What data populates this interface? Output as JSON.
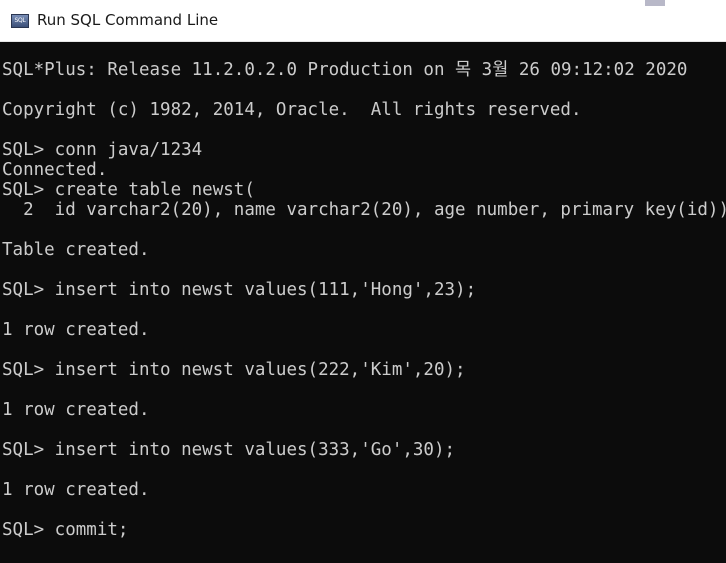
{
  "window": {
    "title": "Run SQL Command Line",
    "icon": "sql-plus-app-icon",
    "icon_label": "SQL"
  },
  "console": {
    "background_color": "#0c0c0c",
    "text_color": "#cccccc",
    "lines": [
      "SQL*Plus: Release 11.2.0.2.0 Production on 목 3월 26 09:12:02 2020",
      "",
      "Copyright (c) 1982, 2014, Oracle.  All rights reserved.",
      "",
      "SQL> conn java/1234",
      "Connected.",
      "SQL> create table newst(",
      "  2  id varchar2(20), name varchar2(20), age number, primary key(id));",
      "",
      "Table created.",
      "",
      "SQL> insert into newst values(111,'Hong',23);",
      "",
      "1 row created.",
      "",
      "SQL> insert into newst values(222,'Kim',20);",
      "",
      "1 row created.",
      "",
      "SQL> insert into newst values(333,'Go',30);",
      "",
      "1 row created.",
      "",
      "SQL> commit;"
    ]
  }
}
